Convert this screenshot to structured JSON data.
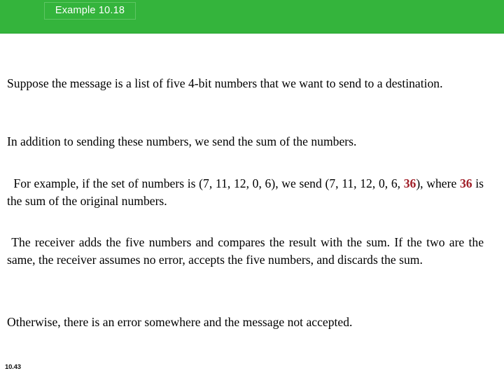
{
  "slide": {
    "header": {
      "title": "Example 10.18",
      "band_color": "#34b43c",
      "band_border_color": "#2aa634",
      "title_box_border_color": "#5ec563",
      "title_color": "#ffffff"
    },
    "body": {
      "text_color": "#000000",
      "highlight_color": "#a01e28",
      "paragraphs": [
        {
          "id": "para-1",
          "indent": false,
          "text": "Suppose the message is a list of five 4-bit numbers that we want to send to a destination."
        },
        {
          "id": "para-2",
          "indent": false,
          "text": "In addition to sending these numbers, we send the sum of the numbers."
        },
        {
          "id": "para-3",
          "indent": true,
          "segments": [
            {
              "text": "For example, if the set of numbers is (7, 11, 12, 0, 6), we send (7, 11, 12, 0, 6, ",
              "highlight": false
            },
            {
              "text": "36",
              "highlight": true
            },
            {
              "text": "), where ",
              "highlight": false
            },
            {
              "text": "36",
              "highlight": true
            },
            {
              "text": " is the sum of the original numbers.",
              "highlight": false
            }
          ]
        },
        {
          "id": "para-4",
          "indent": true,
          "text": "The receiver adds the five numbers and compares the result with the sum. If the two are the same, the receiver assumes no error, accepts the five numbers, and discards the sum."
        },
        {
          "id": "para-5",
          "indent": false,
          "text": "Otherwise, there is an error somewhere and the message not accepted."
        }
      ]
    },
    "footer": {
      "page_number": "10.43"
    }
  }
}
